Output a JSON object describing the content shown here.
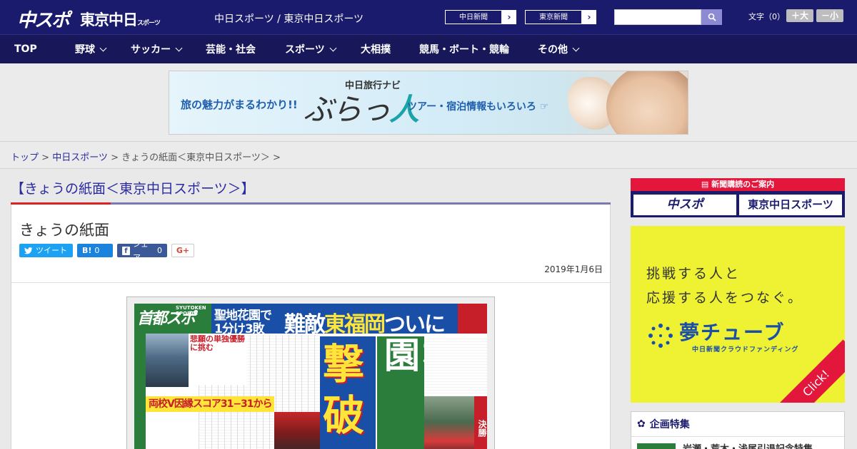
{
  "header": {
    "logo_chuspo": "中スポ",
    "logo_tokyo": "東京中日",
    "logo_tokyo_sub": "スポーツ",
    "site_title": "中日スポーツ / 東京中日スポーツ",
    "ext_links": [
      {
        "label": "中日新聞"
      },
      {
        "label": "東京新聞"
      }
    ],
    "search": {
      "value": "",
      "placeholder": ""
    },
    "font_size": {
      "label": "文字（0）",
      "large": "＋大",
      "small": "－小"
    }
  },
  "nav": {
    "items": [
      {
        "label": "TOP",
        "has_menu": false
      },
      {
        "label": "野球",
        "has_menu": true
      },
      {
        "label": "サッカー",
        "has_menu": true
      },
      {
        "label": "芸能・社会",
        "has_menu": false
      },
      {
        "label": "スポーツ",
        "has_menu": true
      },
      {
        "label": "大相撲",
        "has_menu": false
      },
      {
        "label": "競馬・ボート・競輪",
        "has_menu": false
      },
      {
        "label": "その他",
        "has_menu": true
      }
    ]
  },
  "ad_banner": {
    "catch": "旅の魅力がまるわかり!!",
    "brand_small": "中日旅行ナビ",
    "brand": "ぶらっ",
    "brand_hito": "人",
    "sub": "ツアー・宿泊情報もいろいろ"
  },
  "breadcrumb": {
    "items": [
      {
        "label": "トップ",
        "link": true
      },
      {
        "label": "中日スポーツ",
        "link": true
      },
      {
        "label": "きょうの紙面＜東京中日スポーツ＞",
        "link": false
      }
    ],
    "sep": " > "
  },
  "main": {
    "section_title": "【きょうの紙面＜東京中日スポーツ＞】",
    "article_title": "きょうの紙面",
    "social": {
      "tweet": "ツイート",
      "hatena_label": "B!",
      "hatena_count": "0",
      "fb_label": "シェア",
      "fb_count": "0",
      "gplus": "G+"
    },
    "date": "2019年1月6日"
  },
  "newspaper": {
    "logo": "首都スポ",
    "logo_sub": "SYUTOKEN SPORTS",
    "head_line1": "聖地花園で",
    "head_line2": "1分け3敗",
    "head_big": "難敵",
    "head_big_yellow": "東福岡",
    "head_big_end": "ついに",
    "geki": "撃",
    "ha": "破",
    "toin": "桐蔭学園",
    "caption_bold": "悲願の単独優勝に挑む",
    "yellow_band": "両校V因縁スコア31−31から",
    "final": "決勝"
  },
  "sidebar": {
    "subscribe_label": "新聞購読のご案内",
    "sub_chuspo": "中スポ",
    "sub_tokyo": "東京中日スポーツ",
    "yume": {
      "line1": "挑戦する人と",
      "line2": "応援する人をつなぐ。",
      "logo": "夢チューブ",
      "sub": "中日新聞クラウドファンディング",
      "click": "Click!"
    },
    "kikaku": {
      "title": "企画特集",
      "item": "岩瀬・荒木・浅尾引退記念特集"
    }
  },
  "colors": {
    "header_bg": "#1b1b6e",
    "nav_bg": "#17175a",
    "link": "#2b2ba0",
    "accent_red": "#e3163c",
    "yume_bg": "#eef233"
  }
}
